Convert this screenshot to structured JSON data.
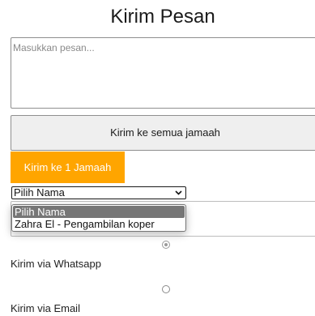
{
  "page": {
    "title": "Kirim Pesan"
  },
  "message": {
    "placeholder": "Masukkan pesan...",
    "value": ""
  },
  "buttons": {
    "send_all": "Kirim ke semua jamaah",
    "send_one": "Kirim ke 1 Jamaah"
  },
  "name_select": {
    "selected": "Pilih Nama",
    "options": [
      "Pilih Nama",
      "Zahra El - Pengambilan koper"
    ]
  },
  "delivery": {
    "whatsapp_label": "Kirim via Whatsapp",
    "email_label": "Kirim via Email",
    "selected": "whatsapp"
  },
  "colors": {
    "accent": "#ffa500",
    "dropdown_highlight": "#767676"
  }
}
